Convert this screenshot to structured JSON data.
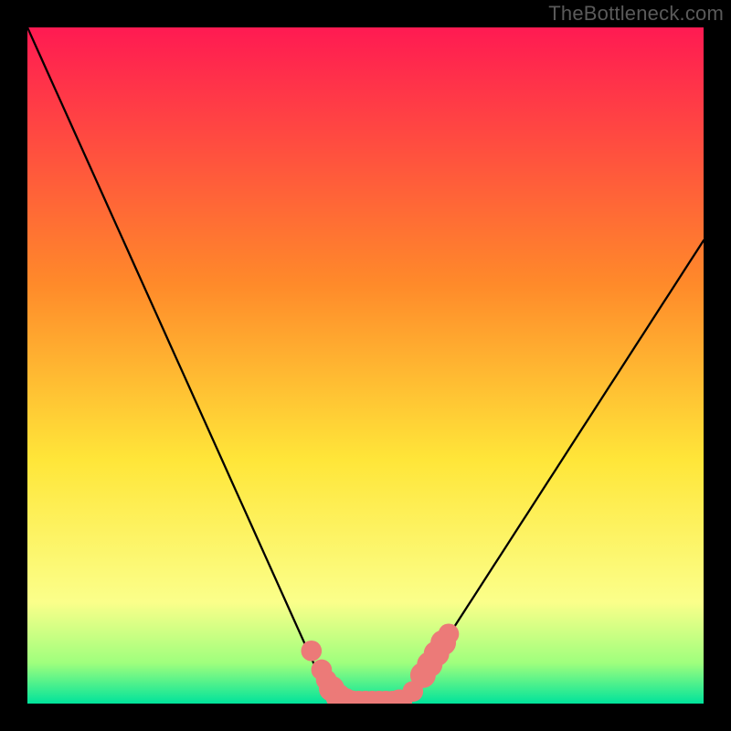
{
  "watermark": "TheBottleneck.com",
  "colors": {
    "bg": "#000000",
    "grad_top": "#ff1a52",
    "grad_mid1": "#ff8a2a",
    "grad_mid2": "#ffe639",
    "grad_low": "#fbff8a",
    "grad_green_top": "#9fff7d",
    "grad_green_bot": "#00e39b",
    "curve": "#000000",
    "marker": "#ec7a78",
    "watermark": "#5a5a5a"
  },
  "chart_data": {
    "type": "line",
    "title": "",
    "xlabel": "",
    "ylabel": "",
    "xlim": [
      0,
      100
    ],
    "ylim": [
      0,
      100
    ],
    "x": [
      0,
      1,
      2,
      3,
      4,
      5,
      6,
      7,
      8,
      9,
      10,
      11,
      12,
      13,
      14,
      15,
      16,
      17,
      18,
      19,
      20,
      21,
      22,
      23,
      24,
      25,
      26,
      27,
      28,
      29,
      30,
      31,
      32,
      33,
      34,
      35,
      36,
      37,
      38,
      39,
      40,
      41,
      42,
      43,
      44,
      45,
      46,
      47,
      48,
      49,
      50,
      51,
      52,
      53,
      54,
      55,
      56,
      57,
      58,
      59,
      60,
      61,
      62,
      63,
      64,
      65,
      66,
      67,
      68,
      69,
      70,
      71,
      72,
      73,
      74,
      75,
      76,
      77,
      78,
      79,
      80,
      81,
      82,
      83,
      84,
      85,
      86,
      87,
      88,
      89,
      90,
      91,
      92,
      93,
      94,
      95,
      96,
      97,
      98,
      99,
      100
    ],
    "values": [
      100.0,
      97.78,
      95.56,
      93.33,
      91.11,
      88.89,
      86.67,
      84.44,
      82.22,
      80.0,
      77.78,
      75.56,
      73.33,
      71.11,
      68.89,
      66.67,
      64.44,
      62.22,
      60.0,
      57.78,
      55.56,
      53.33,
      51.11,
      48.89,
      46.67,
      44.44,
      42.22,
      40.0,
      37.78,
      35.56,
      33.33,
      31.11,
      28.89,
      26.67,
      24.44,
      22.22,
      20.0,
      17.78,
      15.56,
      13.33,
      11.11,
      8.89,
      6.67,
      4.6,
      2.8,
      1.4,
      0.5,
      0.08,
      0.0,
      0.0,
      0.0,
      0.0,
      0.0,
      0.0,
      0.0,
      0.1,
      0.6,
      1.5,
      2.8,
      4.4,
      6.2,
      8.0,
      9.6,
      11.15,
      12.7,
      14.25,
      15.8,
      17.35,
      18.9,
      20.45,
      22.0,
      23.55,
      25.1,
      26.65,
      28.2,
      29.75,
      31.3,
      32.85,
      34.4,
      35.95,
      37.5,
      39.05,
      40.6,
      42.15,
      43.7,
      45.25,
      46.8,
      48.35,
      49.9,
      51.45,
      53.0,
      54.55,
      56.1,
      57.65,
      59.2,
      60.75,
      62.3,
      63.85,
      65.4,
      66.95,
      68.5
    ],
    "segment_markers": [
      {
        "x": 42.0,
        "y": 7.8,
        "r": 1.1
      },
      {
        "x": 43.5,
        "y": 5.0,
        "r": 1.1
      },
      {
        "x": 44.2,
        "y": 3.5,
        "r": 1.1
      },
      {
        "x": 45.0,
        "y": 2.2,
        "r": 1.5
      },
      {
        "x": 46.0,
        "y": 1.0,
        "r": 1.5
      },
      {
        "x": 47.0,
        "y": 0.4,
        "r": 1.5
      },
      {
        "x": 48.0,
        "y": 0.05,
        "r": 1.5
      },
      {
        "x": 49.0,
        "y": 0.0,
        "r": 1.5
      },
      {
        "x": 50.0,
        "y": 0.0,
        "r": 1.5
      },
      {
        "x": 51.0,
        "y": 0.0,
        "r": 1.5
      },
      {
        "x": 52.0,
        "y": 0.0,
        "r": 1.5
      },
      {
        "x": 53.0,
        "y": 0.0,
        "r": 1.5
      },
      {
        "x": 54.0,
        "y": 0.0,
        "r": 1.5
      },
      {
        "x": 55.0,
        "y": 0.2,
        "r": 1.5
      },
      {
        "x": 57.0,
        "y": 1.8,
        "r": 1.1
      },
      {
        "x": 58.5,
        "y": 4.2,
        "r": 1.5
      },
      {
        "x": 59.5,
        "y": 5.8,
        "r": 1.5
      },
      {
        "x": 60.5,
        "y": 7.4,
        "r": 1.5
      },
      {
        "x": 61.5,
        "y": 9.0,
        "r": 1.5
      },
      {
        "x": 62.3,
        "y": 10.3,
        "r": 1.1
      }
    ]
  }
}
